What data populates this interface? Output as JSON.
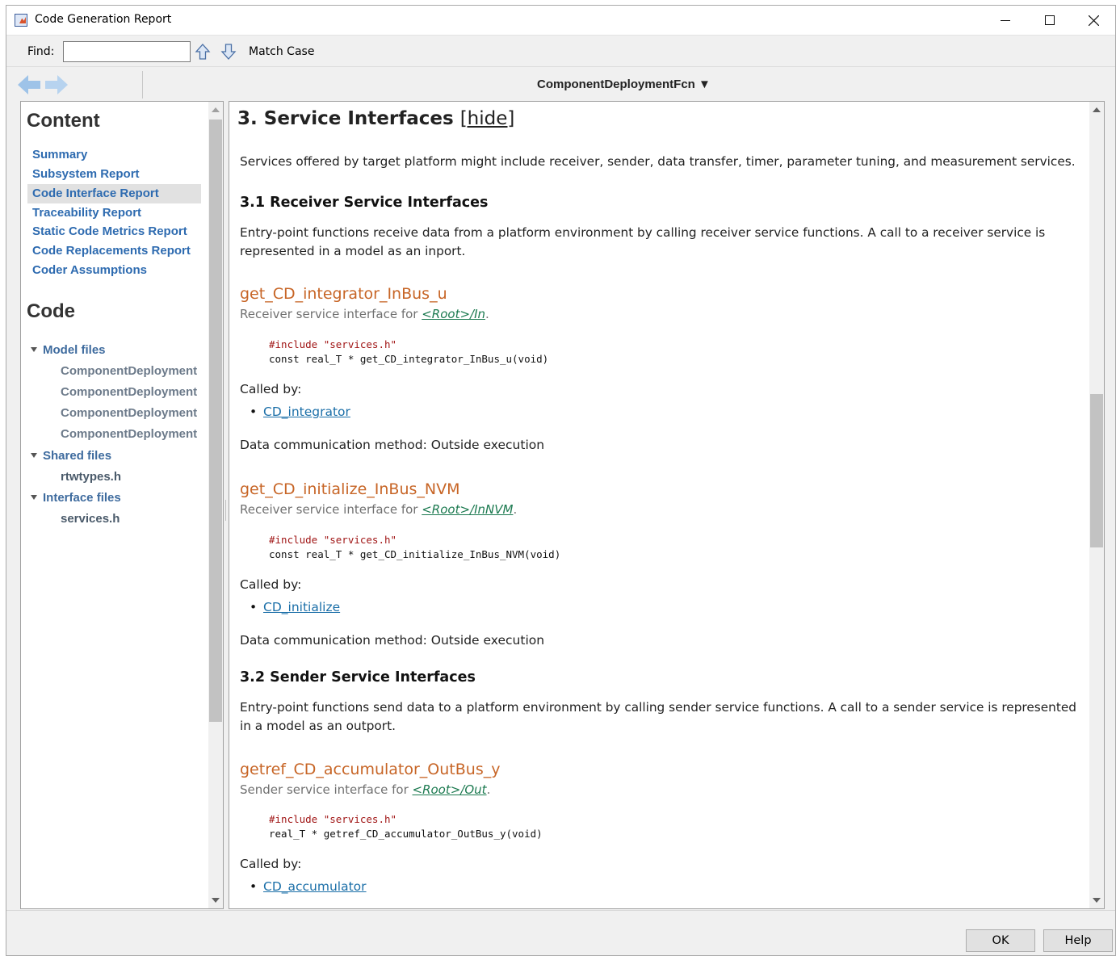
{
  "window": {
    "title": "Code Generation Report",
    "minimize_icon": "minimize-icon",
    "maximize_icon": "maximize-icon",
    "close_icon": "close-icon"
  },
  "findbar": {
    "label": "Find:",
    "value": "",
    "up_icon": "arrow-up-icon",
    "down_icon": "arrow-down-icon",
    "match_case": "Match Case"
  },
  "nav": {
    "back_icon": "back-arrow-icon",
    "forward_icon": "forward-arrow-icon",
    "document": "ComponentDeploymentFcn ▼"
  },
  "sidebar": {
    "content_title": "Content",
    "content_items": [
      {
        "label": "Summary"
      },
      {
        "label": "Subsystem Report"
      },
      {
        "label": "Code Interface Report",
        "active": true
      },
      {
        "label": "Traceability Report"
      },
      {
        "label": "Static Code Metrics Report"
      },
      {
        "label": "Code Replacements Report"
      },
      {
        "label": "Coder Assumptions"
      }
    ],
    "code_title": "Code",
    "model_files": {
      "label": "Model files",
      "files": [
        "ComponentDeployment",
        "ComponentDeployment",
        "ComponentDeployment",
        "ComponentDeployment"
      ]
    },
    "shared_files": {
      "label": "Shared files",
      "files": [
        "rtwtypes.h"
      ]
    },
    "interface_files": {
      "label": "Interface files",
      "files": [
        "services.h"
      ]
    }
  },
  "main": {
    "section_title": "3. Service Interfaces ",
    "hide_link": "[hide]",
    "intro": "Services offered by target platform might include receiver, sender, data transfer, timer, parameter tuning, and measurement services.",
    "receiver": {
      "title": "3.1 Receiver Service Interfaces",
      "description": "Entry-point functions receive data from a platform environment by calling receiver service functions. A call to a receiver service is represented in a model as an inport.",
      "functions": [
        {
          "name": "get_CD_integrator_InBus_u",
          "desc_prefix": "Receiver service interface for ",
          "desc_link": "<Root>/In",
          "desc_suffix": ".",
          "include": "#include \"services.h\"",
          "signature": "const real_T * get_CD_integrator_InBus_u(void)",
          "called_by_label": "Called by:",
          "caller": "CD_integrator",
          "method": "Data communication method: Outside execution"
        },
        {
          "name": "get_CD_initialize_InBus_NVM",
          "desc_prefix": "Receiver service interface for ",
          "desc_link": "<Root>/InNVM",
          "desc_suffix": ".",
          "include": "#include \"services.h\"",
          "signature": "const real_T * get_CD_initialize_InBus_NVM(void)",
          "called_by_label": "Called by:",
          "caller": "CD_initialize",
          "method": "Data communication method: Outside execution"
        }
      ]
    },
    "sender": {
      "title": "3.2 Sender Service Interfaces",
      "description": "Entry-point functions send data to a platform environment by calling sender service functions. A call to a sender service is represented in a model as an outport.",
      "functions": [
        {
          "name": "getref_CD_accumulator_OutBus_y",
          "desc_prefix": "Sender service interface for ",
          "desc_link": "<Root>/Out",
          "desc_suffix": ".",
          "include": "#include \"services.h\"",
          "signature": "real_T * getref_CD_accumulator_OutBus_y(void)",
          "called_by_label": "Called by:",
          "caller": "CD_accumulator"
        }
      ]
    }
  },
  "buttons": {
    "ok": "OK",
    "help": "Help"
  },
  "colors": {
    "link_blue": "#2e6bb0",
    "function_orange": "#c76526",
    "path_green": "#1c7a50",
    "preprocessor_red": "#a01515"
  }
}
